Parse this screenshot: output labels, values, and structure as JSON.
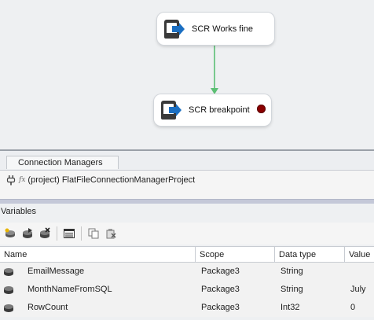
{
  "tasks": [
    {
      "label": "SCR Works fine",
      "has_breakpoint": false
    },
    {
      "label": "SCR breakpoint",
      "has_breakpoint": true
    }
  ],
  "connector_color": "#5cbf74",
  "breakpoint_color": "#8b0000",
  "connection_managers": {
    "tab_label": "Connection Managers",
    "items": [
      {
        "icon": "plug-icon",
        "prefix": "fx",
        "label": "(project) FlatFileConnectionManagerProject"
      }
    ]
  },
  "variables": {
    "title": "Variables",
    "toolbar": [
      {
        "icon": "add-variable-icon"
      },
      {
        "icon": "move-variable-icon"
      },
      {
        "icon": "delete-variable-icon"
      },
      {
        "icon": "grid-options-icon"
      },
      {
        "icon": "copy-icon"
      },
      {
        "icon": "paste-icon"
      }
    ],
    "columns": [
      "Name",
      "Scope",
      "Data type",
      "Value"
    ],
    "rows": [
      {
        "name": "EmailMessage",
        "scope": "Package3",
        "type": "String",
        "value": ""
      },
      {
        "name": "MonthNameFromSQL",
        "scope": "Package3",
        "type": "String",
        "value": "July"
      },
      {
        "name": "RowCount",
        "scope": "Package3",
        "type": "Int32",
        "value": "0"
      }
    ]
  }
}
